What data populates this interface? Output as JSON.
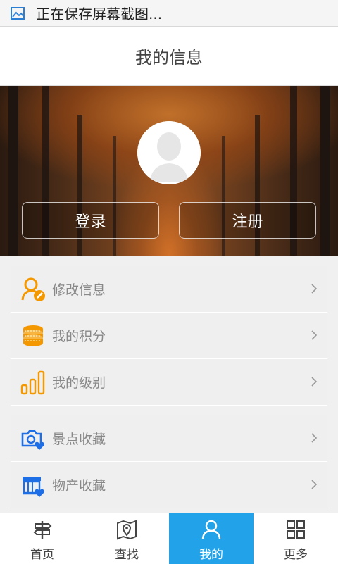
{
  "status_bar": {
    "notification_text": "正在保存屏幕截图..."
  },
  "header": {
    "title": "我的信息"
  },
  "profile": {
    "login_label": "登录",
    "register_label": "注册"
  },
  "menu_group_1": [
    {
      "label": "修改信息",
      "icon": "edit-profile-icon"
    },
    {
      "label": "我的积分",
      "icon": "coins-icon"
    },
    {
      "label": "我的级别",
      "icon": "level-bars-icon"
    }
  ],
  "menu_group_2": [
    {
      "label": "景点收藏",
      "icon": "camera-heart-icon"
    },
    {
      "label": "物产收藏",
      "icon": "shop-heart-icon"
    }
  ],
  "tabs": [
    {
      "label": "首页",
      "icon": "signpost-icon",
      "active": false
    },
    {
      "label": "查找",
      "icon": "map-pin-icon",
      "active": false
    },
    {
      "label": "我的",
      "icon": "person-icon",
      "active": true
    },
    {
      "label": "更多",
      "icon": "grid-icon",
      "active": false
    }
  ],
  "colors": {
    "accent": "#22a2e8",
    "orange": "#f39800",
    "blue": "#1e6ee6"
  }
}
